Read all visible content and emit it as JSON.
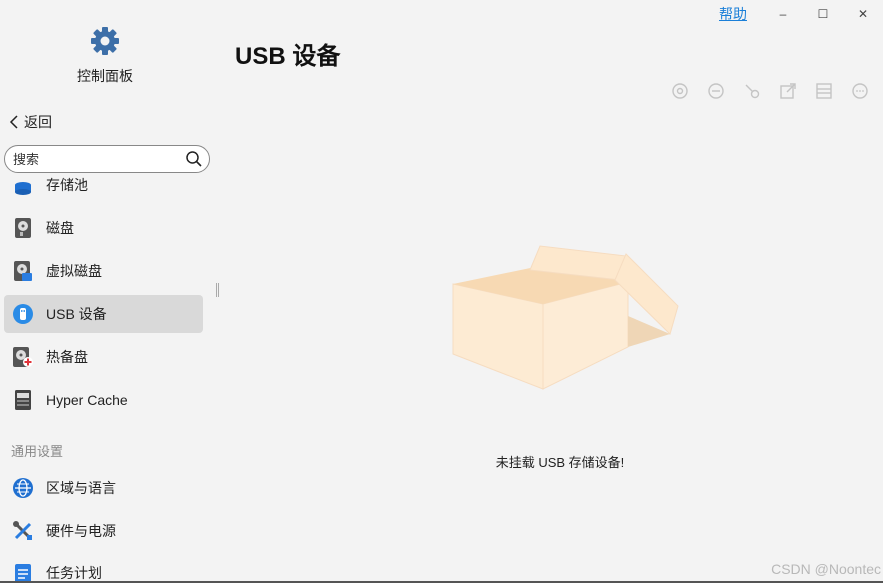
{
  "window": {
    "help_label": "帮助",
    "minimize": "–",
    "maximize": "☐",
    "close": "✕"
  },
  "app": {
    "title": "控制面板",
    "icon": "gear-icon"
  },
  "nav": {
    "back_label": "返回"
  },
  "search": {
    "placeholder": "搜索",
    "value": ""
  },
  "sidebar": {
    "items": [
      {
        "label": "存储池",
        "icon": "storage-pool-icon"
      },
      {
        "label": "磁盘",
        "icon": "disk-icon"
      },
      {
        "label": "虚拟磁盘",
        "icon": "virtual-disk-icon"
      },
      {
        "label": "USB 设备",
        "icon": "usb-icon",
        "active": true
      },
      {
        "label": "热备盘",
        "icon": "hot-spare-icon"
      },
      {
        "label": "Hyper Cache",
        "icon": "ssd-cache-icon"
      }
    ],
    "section_general": "通用设置",
    "general_items": [
      {
        "label": "区域与语言",
        "icon": "globe-icon"
      },
      {
        "label": "硬件与电源",
        "icon": "tools-icon"
      },
      {
        "label": "任务计划",
        "icon": "task-icon"
      }
    ]
  },
  "main": {
    "title": "USB 设备",
    "toolbar": [
      "eject-icon",
      "remove-icon",
      "unmount-icon",
      "export-icon",
      "format-icon",
      "more-icon"
    ],
    "empty_message": "未挂载 USB 存储设备!"
  },
  "watermark": "CSDN @Noontec",
  "colors": {
    "accent": "#1a7fd8",
    "active_bg": "#d9d9d9",
    "box_light": "#fde9cf",
    "box_dark": "#f3d9b5"
  }
}
